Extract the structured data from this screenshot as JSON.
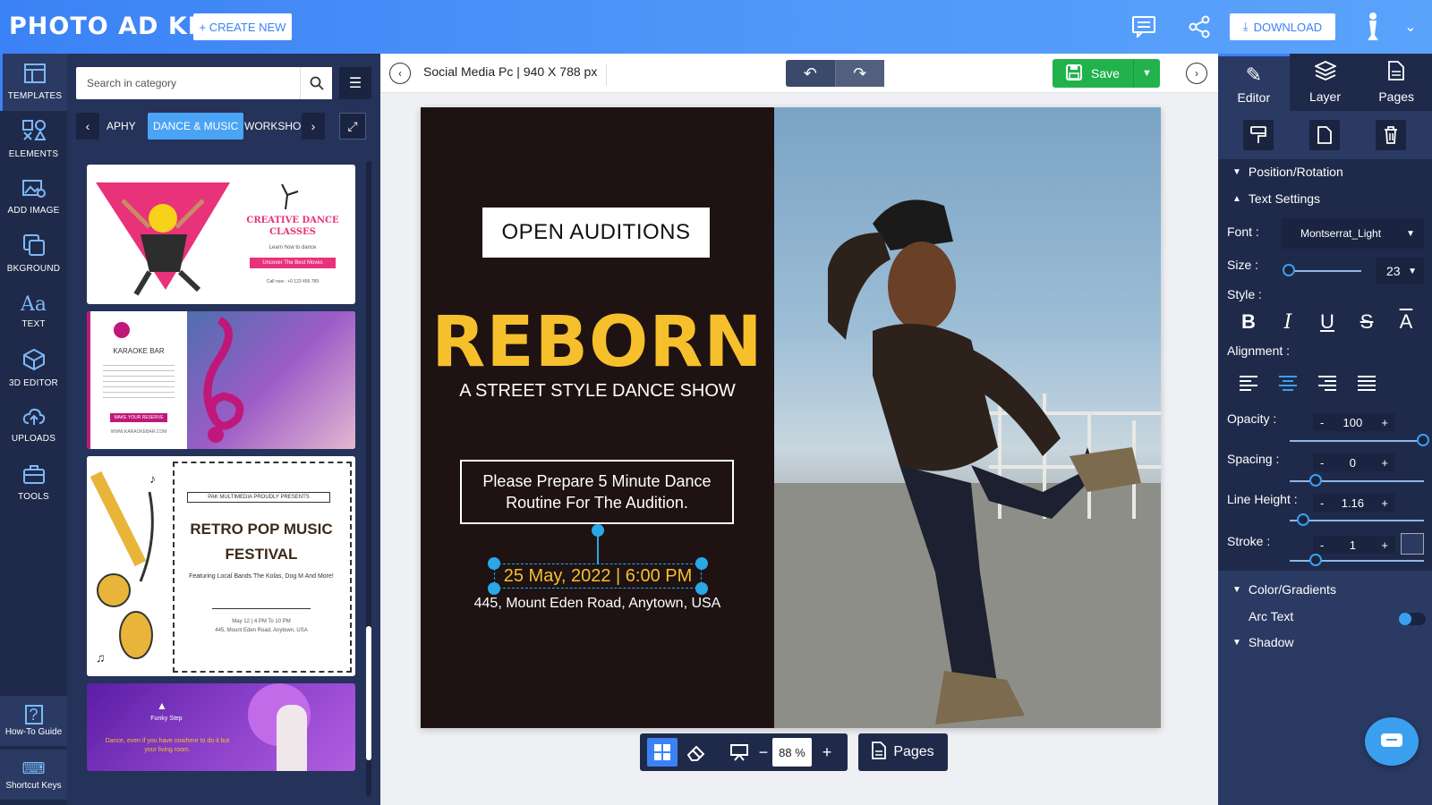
{
  "app": {
    "logo": "PHOTO AD KING",
    "create_label": "+ CREATE NEW",
    "download_label": "DOWNLOAD"
  },
  "rail": {
    "items": [
      {
        "label": "TEMPLATES",
        "icon": "templates-icon"
      },
      {
        "label": "ELEMENTS",
        "icon": "elements-icon"
      },
      {
        "label": "ADD IMAGE",
        "icon": "add-image-icon"
      },
      {
        "label": "BKGROUND",
        "icon": "background-icon"
      },
      {
        "label": "TEXT",
        "icon": "text-icon"
      },
      {
        "label": "3D EDITOR",
        "icon": "3d-editor-icon"
      },
      {
        "label": "UPLOADS",
        "icon": "uploads-icon"
      },
      {
        "label": "TOOLS",
        "icon": "tools-icon"
      }
    ],
    "guide_label": "How-To Guide",
    "shortcut_label": "Shortcut Keys"
  },
  "panel": {
    "search_placeholder": "Search in category",
    "categories": [
      "APHY",
      "DANCE & MUSIC",
      "WORKSHO"
    ],
    "thumbs": [
      {
        "title": "CREATIVE DANCE CLASSES",
        "sub": "Learn how to dance",
        "cta": "Uncover The Best Moves",
        "contact": "Call now : +0 123 456 789"
      },
      {
        "title": "KARAOKE BAR",
        "cta": "MAKE YOUR RESERVE",
        "url": "WWW.KARAOKEBAR.COM"
      },
      {
        "pre": "PAK MULTIMEDIA PROUDLY PRESENTS",
        "title": "RETRO POP MUSIC FESTIVAL",
        "sub": "Featuring Local Bands The Kolas, Dog M And More!",
        "date": "May 12 | 4 PM To 10 PM",
        "address": "445, Mount Eden Road, Anytown, USA"
      },
      {
        "brand": "Funky Step",
        "tagline": "Dance, even if you have nowhere to do it but your living room."
      }
    ]
  },
  "canvas": {
    "doc_title": "Social Media Pc",
    "doc_size": "940 X 788 px",
    "save_label": "Save",
    "zoom": "88 %",
    "pages_label": "Pages",
    "design": {
      "badge": "OPEN AUDITIONS",
      "headline": "REBORN",
      "subtitle": "A STREET STYLE DANCE SHOW",
      "prepare": "Please Prepare 5 Minute Dance Routine For The Audition.",
      "date": "25 May, 2022 | 6:00 PM",
      "address": "445, Mount Eden Road, Anytown, USA"
    }
  },
  "right": {
    "tabs": [
      "Editor",
      "Layer",
      "Pages"
    ],
    "sections": {
      "position": "Position/Rotation",
      "text": "Text Settings",
      "color": "Color/Gradients",
      "arc": "Arc Text",
      "shadow": "Shadow"
    },
    "font_label": "Font :",
    "font_value": "Montserrat_Light",
    "size_label": "Size :",
    "size_value": "23",
    "style_label": "Style :",
    "align_label": "Alignment :",
    "opacity_label": "Opacity :",
    "opacity_value": "100",
    "spacing_label": "Spacing :",
    "spacing_value": "0",
    "lineheight_label": "Line Height :",
    "lineheight_value": "1.16",
    "stroke_label": "Stroke :",
    "stroke_value": "1"
  },
  "colors": {
    "accent": "#3b82f6",
    "save_green": "#22b24c",
    "headline_yellow": "#f5c02b",
    "selection_blue": "#2aa8e6"
  }
}
